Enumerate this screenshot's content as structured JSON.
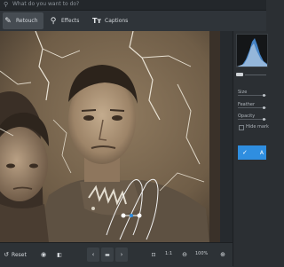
{
  "search": {
    "placeholder": "What do you want to do?"
  },
  "tabs": [
    {
      "label": "Retouch",
      "icon": "brush-icon",
      "active": true
    },
    {
      "label": "Effects",
      "icon": "magic-wand-icon",
      "active": false
    },
    {
      "label": "Captions",
      "icon": "text-icon",
      "active": false
    }
  ],
  "panel": {
    "size_label": "Size",
    "feather_label": "Feather",
    "opacity_label": "Opacity",
    "hide_markers_label": "Hide mark",
    "apply_label": "A"
  },
  "bottom": {
    "reset_label": "Reset",
    "zoom_ratio": "1:1",
    "zoom_percent": "100%"
  },
  "colors": {
    "accent": "#2f8ee0",
    "active_tab": "#464c52",
    "background": "#2b2f33"
  }
}
